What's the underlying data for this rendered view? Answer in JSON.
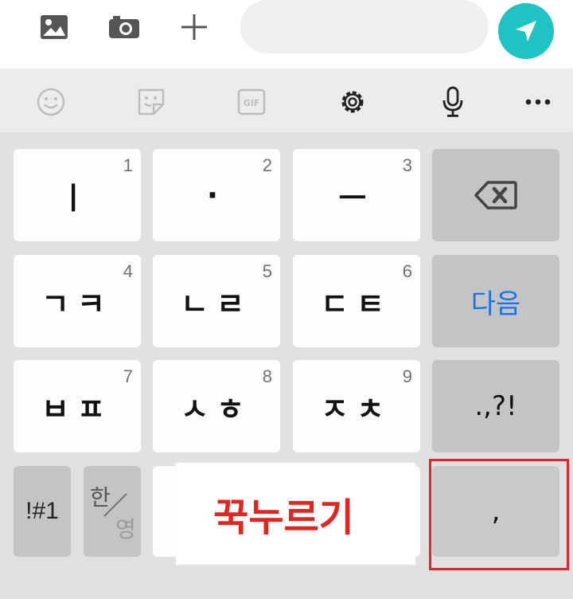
{
  "compose": {
    "icons": [
      "image-icon",
      "camera-icon",
      "plus-icon"
    ],
    "input_placeholder": "",
    "send_icon": "send-icon",
    "send_color": "#20c3c3"
  },
  "toolbar": {
    "icons": [
      "emoji-icon",
      "sticker-icon",
      "gif-icon",
      "gear-icon",
      "microphone-icon",
      "more-icon"
    ],
    "gif_label": "GIF"
  },
  "keyboard": {
    "rows": [
      [
        {
          "label": "ㅣ",
          "num": "1"
        },
        {
          "label": "·",
          "num": "2"
        },
        {
          "label": "ㅡ",
          "num": "3"
        },
        {
          "label": "backspace-icon"
        }
      ],
      [
        {
          "label": "ㄱㅋ",
          "num": "4"
        },
        {
          "label": "ㄴㄹ",
          "num": "5"
        },
        {
          "label": "ㄷㅌ",
          "num": "6"
        },
        {
          "label": "다음"
        }
      ],
      [
        {
          "label": "ㅂㅍ",
          "num": "7"
        },
        {
          "label": "ㅅㅎ",
          "num": "8"
        },
        {
          "label": "ㅈㅊ",
          "num": "9"
        },
        {
          "label": ".,?!"
        }
      ],
      [
        {
          "label": "!#1"
        },
        {
          "label_top": "한",
          "label_bottom": "영"
        },
        {
          "label": ""
        },
        {
          "label": ","
        }
      ]
    ],
    "accent_color": "#1a73e8"
  },
  "annotation": {
    "text": "꾹누르기",
    "color": "#e2251f",
    "highlight_color": "#e3242b"
  }
}
